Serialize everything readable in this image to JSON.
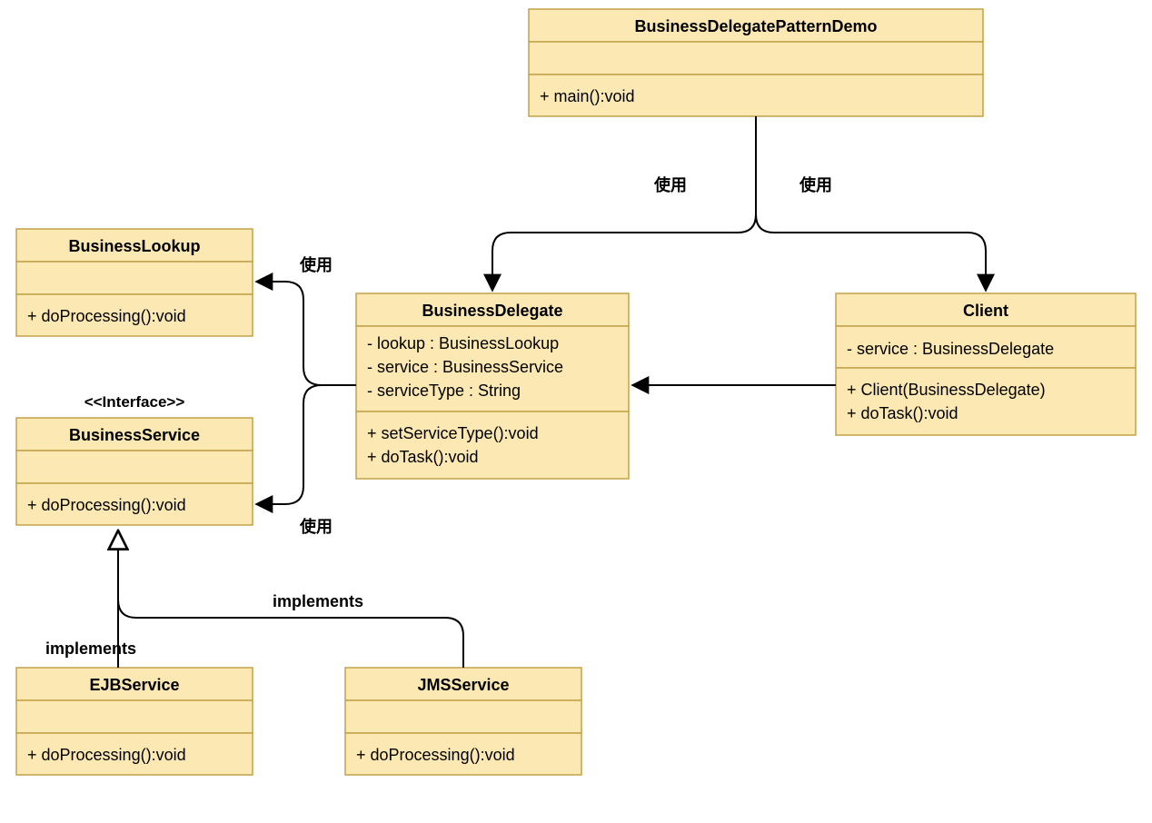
{
  "diagram": {
    "type": "uml-class",
    "classes": {
      "demo": {
        "name": "BusinessDelegatePatternDemo",
        "attributes": [],
        "methods": [
          "+ main():void"
        ]
      },
      "lookup": {
        "name": "BusinessLookup",
        "attributes": [],
        "methods": [
          "+ doProcessing():void"
        ]
      },
      "service": {
        "stereotype": "<<Interface>>",
        "name": "BusinessService",
        "attributes": [],
        "methods": [
          "+ doProcessing():void"
        ]
      },
      "delegate": {
        "name": "BusinessDelegate",
        "attributes": [
          "- lookup : BusinessLookup",
          "- service : BusinessService",
          "- serviceType : String"
        ],
        "methods": [
          "+ setServiceType():void",
          "+ doTask():void"
        ]
      },
      "client": {
        "name": "Client",
        "attributes": [
          "- service : BusinessDelegate"
        ],
        "methods": [
          "+ Client(BusinessDelegate)",
          "+ doTask():void"
        ]
      },
      "ejb": {
        "name": "EJBService",
        "attributes": [],
        "methods": [
          "+ doProcessing():void"
        ]
      },
      "jms": {
        "name": "JMSService",
        "attributes": [],
        "methods": [
          "+ doProcessing():void"
        ]
      }
    },
    "edges": {
      "demo_delegate": "使用",
      "demo_client": "使用",
      "delegate_lookup": "使用",
      "delegate_service": "使用",
      "client_delegate": "",
      "ejb_service": "implements",
      "jms_service": "implements"
    }
  }
}
